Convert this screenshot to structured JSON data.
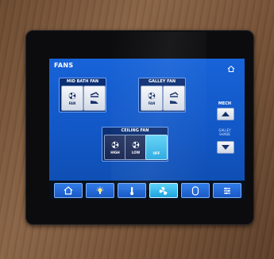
{
  "header": {
    "title": "FANS",
    "home_icon": "home-icon"
  },
  "groups": {
    "mid_bath": {
      "title": "MID BATH FAN",
      "fan_label": "FAN",
      "fan_icon": "fan-icon",
      "vent_icon": "vent-lid-icon"
    },
    "galley": {
      "title": "GALLEY FAN",
      "fan_label": "FAN",
      "fan_icon": "fan-icon",
      "vent_icon": "vent-lid-icon"
    },
    "ceiling": {
      "title": "CEILING FAN",
      "buttons": [
        {
          "label": "HIGH",
          "icon": "fan-icon",
          "active": false
        },
        {
          "label": "LOW",
          "icon": "fan-icon",
          "active": false
        },
        {
          "label": "OFF",
          "icon": "",
          "active": true
        }
      ]
    }
  },
  "mech": {
    "title": "MECH",
    "label_line1": "GALLEY",
    "label_line2": "SHADE",
    "up_icon": "arrow-up-icon",
    "down_icon": "arrow-down-icon"
  },
  "nav": [
    {
      "icon": "home-icon",
      "active": false
    },
    {
      "icon": "light-bulb-icon",
      "active": false
    },
    {
      "icon": "thermometer-icon",
      "active": false
    },
    {
      "icon": "fan-icon",
      "active": true
    },
    {
      "icon": "tank-icon",
      "active": false
    },
    {
      "icon": "settings-icon",
      "active": false
    }
  ],
  "colors": {
    "panel_blue": "#1763d8",
    "active_cyan": "#27a8e0",
    "group_navy": "#0c2f74"
  }
}
